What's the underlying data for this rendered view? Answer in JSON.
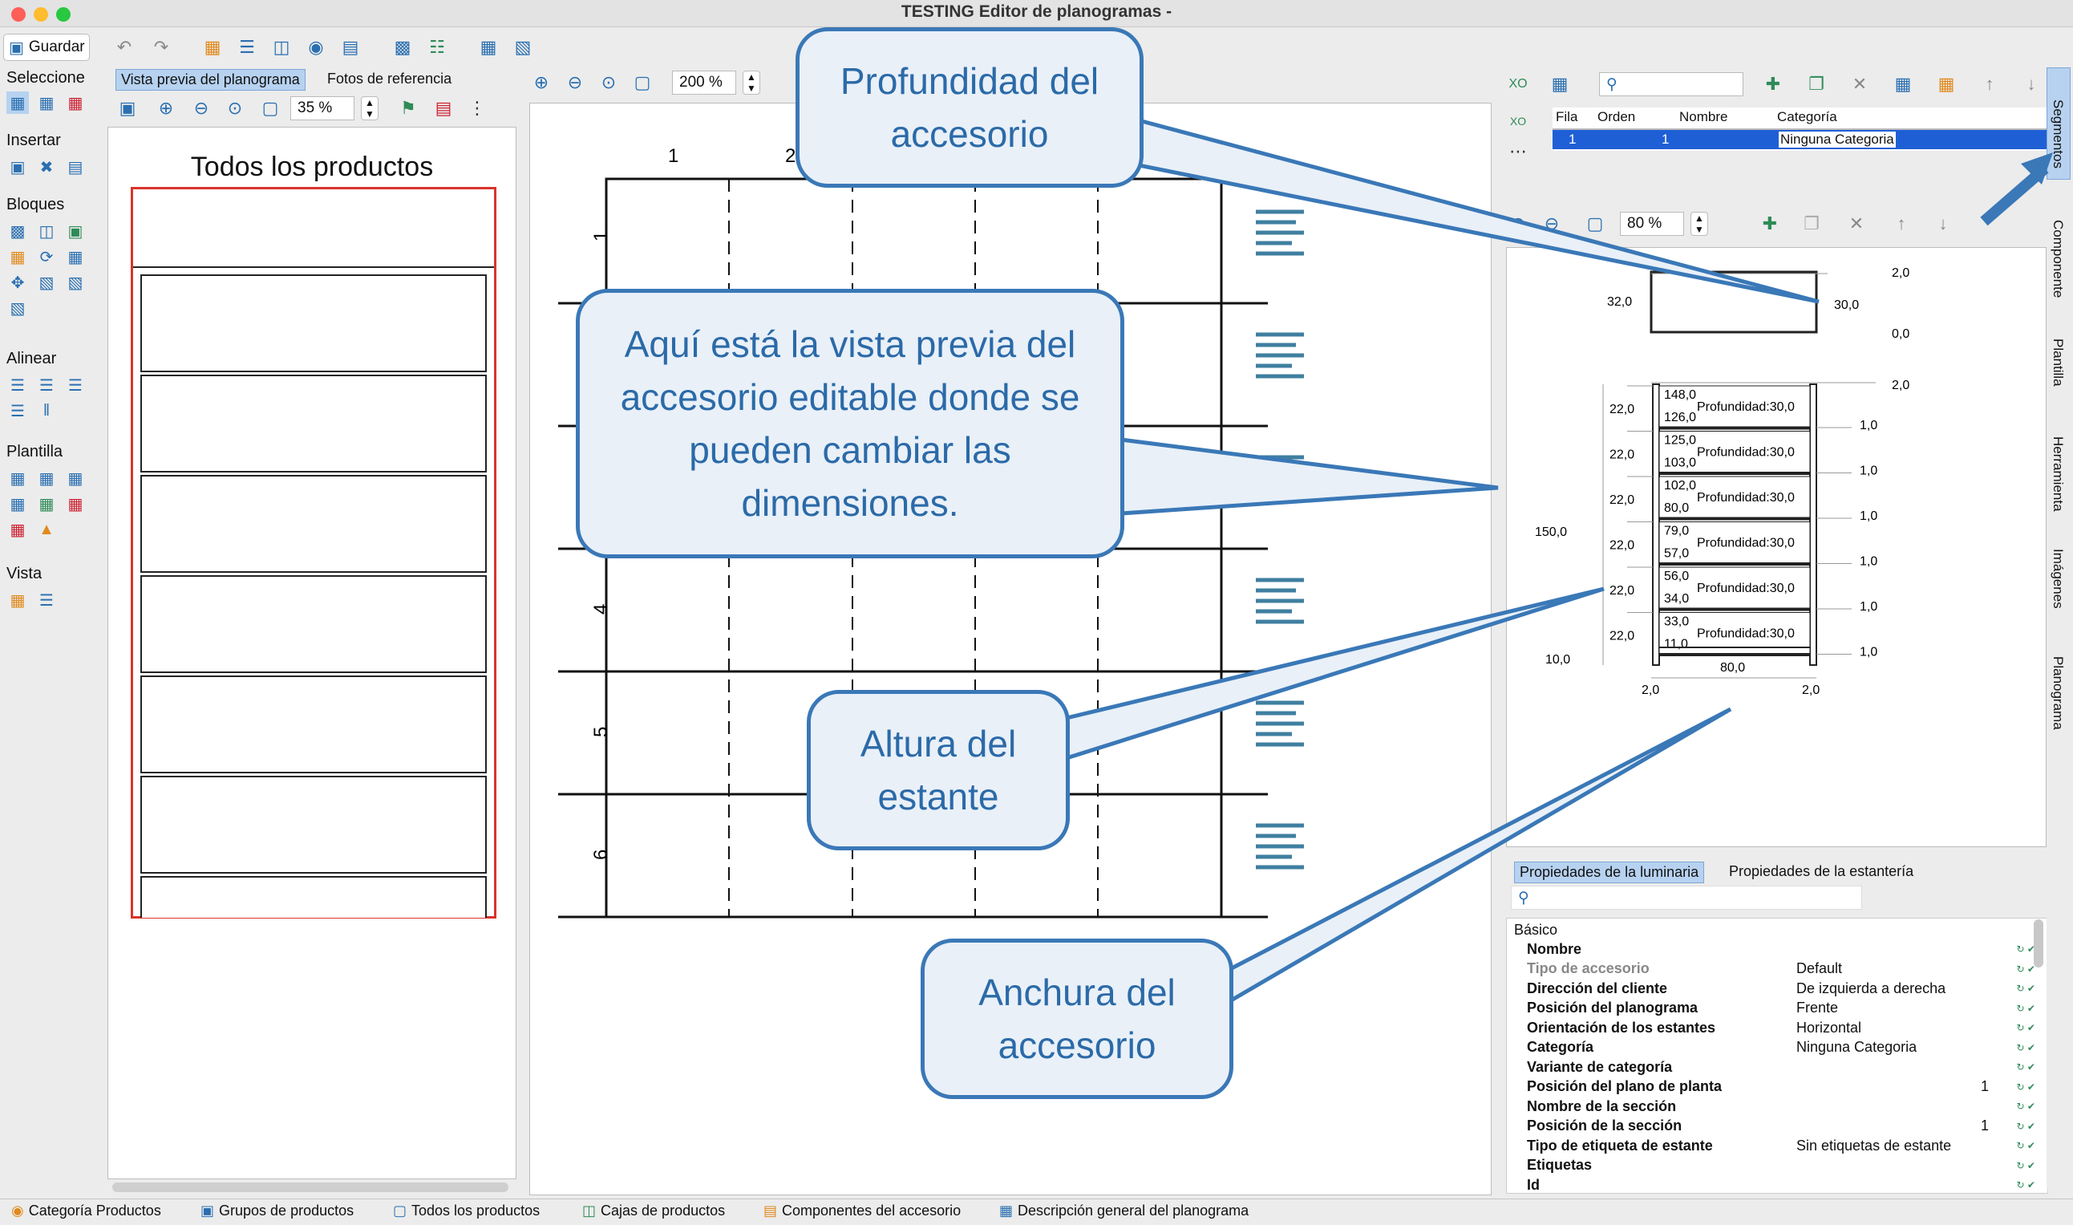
{
  "window": {
    "title": "TESTING Editor de planogramas -"
  },
  "toolbar": {
    "save_label": "Guardar"
  },
  "leftbar": {
    "sections": [
      "Seleccione",
      "Insertar",
      "Bloques",
      "Alinear",
      "Plantilla",
      "Vista"
    ]
  },
  "preview": {
    "tabs": [
      "Vista previa del planograma",
      "Fotos de referencia"
    ],
    "zoom": "35 %",
    "heading": "Todos los productos"
  },
  "canvas": {
    "zoom": "200 %",
    "column_labels": [
      "1",
      "2"
    ],
    "row_labels": [
      "1",
      "4",
      "5",
      "6"
    ]
  },
  "segments": {
    "columns": [
      "Fila",
      "Orden",
      "Nombre",
      "Categoría"
    ],
    "rows": [
      {
        "fila": "1",
        "orden": "1",
        "nombre": "",
        "categoria": "Ninguna Categoria"
      }
    ]
  },
  "fixture": {
    "zoom": "80 %",
    "top": {
      "left": "32,0",
      "right_top": "2,0",
      "right_mid": "30,0",
      "right_bottom": "0,0"
    },
    "total_height": "150,0",
    "top_margin": "2,0",
    "shelves": [
      {
        "upper": "148,0",
        "lower": "126,0",
        "depth": "Profundidad:30,0",
        "height": "22,0",
        "gap": "1,0"
      },
      {
        "upper": "125,0",
        "lower": "103,0",
        "depth": "Profundidad:30,0",
        "height": "22,0",
        "gap": "1,0"
      },
      {
        "upper": "102,0",
        "lower": "80,0",
        "depth": "Profundidad:30,0",
        "height": "22,0",
        "gap": "1,0"
      },
      {
        "upper": "79,0",
        "lower": "57,0",
        "depth": "Profundidad:30,0",
        "height": "22,0",
        "gap": "1,0"
      },
      {
        "upper": "56,0",
        "lower": "34,0",
        "depth": "Profundidad:30,0",
        "height": "22,0",
        "gap": "1,0"
      },
      {
        "upper": "33,0",
        "lower": "11,0",
        "depth": "Profundidad:30,0",
        "height": "22,0",
        "gap": "1,0"
      }
    ],
    "base": "10,0",
    "width": "80,0",
    "side_left": "2,0",
    "side_right": "2,0"
  },
  "properties": {
    "tabs": [
      "Propiedades de la luminaria",
      "Propiedades de la estantería"
    ],
    "group": "Básico",
    "rows": [
      {
        "name": "Nombre",
        "value": ""
      },
      {
        "name": "Tipo de accesorio",
        "value": "Default"
      },
      {
        "name": "Dirección del cliente",
        "value": "De izquierda a derecha"
      },
      {
        "name": "Posición del planograma",
        "value": "Frente"
      },
      {
        "name": "Orientación de los estantes",
        "value": "Horizontal"
      },
      {
        "name": "Categoría",
        "value": "Ninguna Categoria"
      },
      {
        "name": "Variante de categoría",
        "value": ""
      },
      {
        "name": "Posición del plano de planta",
        "value": "1"
      },
      {
        "name": "Nombre de la sección",
        "value": ""
      },
      {
        "name": "Posición de la sección",
        "value": "1"
      },
      {
        "name": "Tipo de etiqueta de estante",
        "value": "Sin etiquetas de estante"
      },
      {
        "name": "Etiquetas",
        "value": ""
      },
      {
        "name": "Id",
        "value": ""
      }
    ]
  },
  "side_tabs": [
    "Segmentos",
    "Componente",
    "Plantilla",
    "Herramienta",
    "Imágenes",
    "Planograma"
  ],
  "bottom_tabs": [
    "Categoría Productos",
    "Grupos de productos",
    "Todos los productos",
    "Cajas de productos",
    "Componentes del accesorio",
    "Descripción general del planograma"
  ],
  "callouts": {
    "depth": "Profundidad del accesorio",
    "preview": "Aquí está la vista previa del accesorio editable donde se pueden cambiar las dimensiones.",
    "shelf_height": "Altura del estante",
    "width": "Anchura del accesorio"
  },
  "colors": {
    "accent": "#3a78b7",
    "selection": "#1f5fd6",
    "callout_bg": "#e9f0f8",
    "preview_border": "#d9342b"
  }
}
